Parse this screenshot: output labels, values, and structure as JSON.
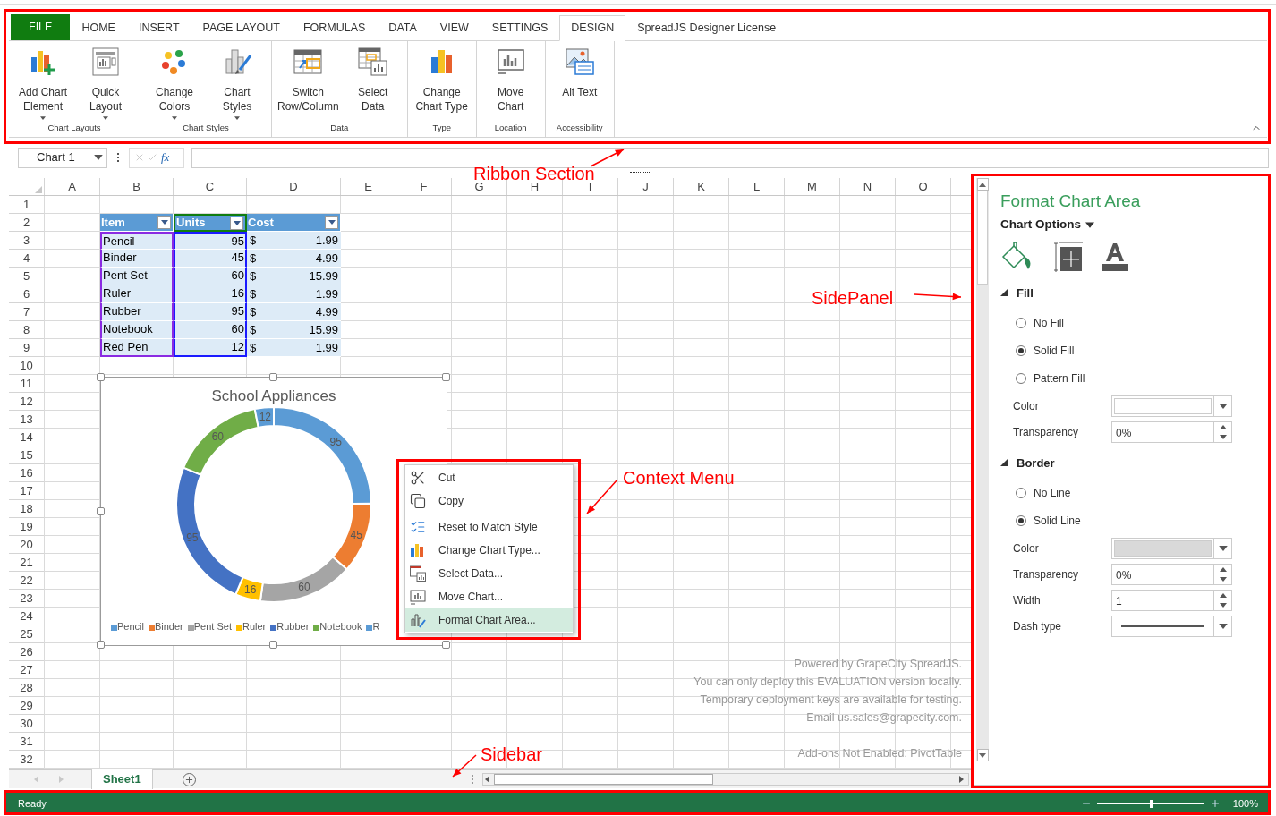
{
  "ribbon": {
    "tabs": [
      {
        "label": "FILE",
        "kind": "file",
        "selected": false
      },
      {
        "label": "HOME",
        "kind": "tab",
        "selected": false
      },
      {
        "label": "INSERT",
        "kind": "tab",
        "selected": false
      },
      {
        "label": "PAGE LAYOUT",
        "kind": "tab",
        "selected": false
      },
      {
        "label": "FORMULAS",
        "kind": "tab",
        "selected": false
      },
      {
        "label": "DATA",
        "kind": "tab",
        "selected": false
      },
      {
        "label": "VIEW",
        "kind": "tab",
        "selected": false
      },
      {
        "label": "SETTINGS",
        "kind": "tab",
        "selected": false
      },
      {
        "label": "DESIGN",
        "kind": "tab",
        "selected": true
      },
      {
        "label": "SpreadJS Designer License",
        "kind": "tab",
        "selected": false
      }
    ],
    "groups": [
      {
        "label": "Chart Layouts",
        "buttons": [
          {
            "label": "Add Chart\nElement",
            "kind": "add-chart",
            "dropdown": true
          },
          {
            "label": "Quick\nLayout",
            "kind": "quick-layout",
            "dropdown": true
          }
        ]
      },
      {
        "label": "Chart Styles",
        "buttons": [
          {
            "label": "Change\nColors",
            "kind": "change-colors",
            "dropdown": true
          },
          {
            "label": "Chart\nStyles",
            "kind": "chart-styles",
            "dropdown": true
          }
        ]
      },
      {
        "label": "Data",
        "buttons": [
          {
            "label": "Switch\nRow/Column",
            "kind": "switch",
            "dropdown": false
          },
          {
            "label": "Select\nData",
            "kind": "select-data",
            "dropdown": false
          }
        ]
      },
      {
        "label": "Type",
        "buttons": [
          {
            "label": "Change\nChart Type",
            "kind": "chart-type",
            "dropdown": false
          }
        ]
      },
      {
        "label": "Location",
        "buttons": [
          {
            "label": "Move\nChart",
            "kind": "move-chart",
            "dropdown": false
          }
        ]
      },
      {
        "label": "Accessibility",
        "buttons": [
          {
            "label": "Alt Text",
            "kind": "alt-text",
            "dropdown": false
          }
        ]
      }
    ]
  },
  "formula_bar": {
    "name_box": "Chart 1",
    "fx": "fx"
  },
  "sheet": {
    "columns": [
      "A",
      "B",
      "C",
      "D",
      "E",
      "F",
      "G",
      "H",
      "I",
      "J",
      "K",
      "L",
      "M",
      "N",
      "O"
    ],
    "rows": [
      "1",
      "2",
      "3",
      "4",
      "5",
      "6",
      "7",
      "8",
      "9",
      "10",
      "11",
      "12",
      "13",
      "14",
      "15",
      "16",
      "17",
      "18",
      "19",
      "20",
      "21",
      "22",
      "23",
      "24",
      "25",
      "26",
      "27",
      "28",
      "29",
      "30",
      "31",
      "32"
    ],
    "table": {
      "columns": [
        {
          "label": "Item",
          "selected": false,
          "color": "#8a2be2"
        },
        {
          "label": "Units",
          "selected": true,
          "color": "#1a1aff"
        },
        {
          "label": "Cost",
          "selected": false
        }
      ],
      "rows": [
        {
          "item": "Pencil",
          "units": "95",
          "currency": "$",
          "cost": "1.99"
        },
        {
          "item": "Binder",
          "units": "45",
          "currency": "$",
          "cost": "4.99"
        },
        {
          "item": "Pent Set",
          "units": "60",
          "currency": "$",
          "cost": "15.99"
        },
        {
          "item": "Ruler",
          "units": "16",
          "currency": "$",
          "cost": "1.99"
        },
        {
          "item": "Rubber",
          "units": "95",
          "currency": "$",
          "cost": "4.99"
        },
        {
          "item": "Notebook",
          "units": "60",
          "currency": "$",
          "cost": "15.99"
        },
        {
          "item": "Red Pen",
          "units": "12",
          "currency": "$",
          "cost": "1.99"
        }
      ]
    },
    "notice": [
      "Powered by GrapeCity SpreadJS.",
      "You can only deploy this EVALUATION version locally.",
      "Temporary deployment keys are available for testing.",
      "Email us.sales@grapecity.com."
    ],
    "addons": "Add-ons Not Enabled: PivotTable",
    "sheet_tabs": [
      {
        "label": "Sheet1",
        "selected": true
      }
    ]
  },
  "chart": {
    "chart_data": {
      "type": "donut",
      "title": "School Appliances",
      "categories": [
        "Pencil",
        "Binder",
        "Pent Set",
        "Ruler",
        "Rubber",
        "Notebook",
        "R"
      ],
      "colors": [
        "#5b9bd5",
        "#ed7d31",
        "#a5a5a5",
        "#ffc000",
        "#4472c4",
        "#70ad47",
        "#5b9bd5"
      ],
      "series": [
        {
          "values": [
            95,
            45,
            60,
            16,
            95,
            60,
            12
          ]
        }
      ],
      "data_labels": true
    }
  },
  "context_menu": [
    {
      "label": "Cut",
      "kind": "cut",
      "selected": false
    },
    {
      "label": "Copy",
      "kind": "copy",
      "selected": false
    },
    {
      "kind": "separator"
    },
    {
      "label": "Reset to Match Style",
      "kind": "reset",
      "selected": false
    },
    {
      "label": "Change Chart Type...",
      "kind": "chart-type",
      "selected": false
    },
    {
      "label": "Select Data...",
      "kind": "select-data",
      "selected": false
    },
    {
      "label": "Move Chart...",
      "kind": "move-chart",
      "selected": false
    },
    {
      "label": "Format Chart Area...",
      "kind": "format",
      "selected": true
    }
  ],
  "side_panel": {
    "title": "Format Chart Area",
    "options_label": "Chart Options",
    "sections": [
      {
        "title": "Fill",
        "expanded": true,
        "options": [
          {
            "label": "No Fill",
            "selected": false
          },
          {
            "label": "Solid Fill",
            "selected": true
          },
          {
            "label": "Pattern Fill",
            "selected": false
          }
        ],
        "fields": [
          {
            "label": "Color",
            "kind": "color",
            "color": "#ffffff"
          },
          {
            "label": "Transparency",
            "kind": "spin",
            "value": "0%"
          }
        ]
      },
      {
        "title": "Border",
        "expanded": true,
        "options": [
          {
            "label": "No Line",
            "selected": false
          },
          {
            "label": "Solid Line",
            "selected": true
          }
        ],
        "fields": [
          {
            "label": "Color",
            "kind": "color",
            "color": "#d9d9d9"
          },
          {
            "label": "Transparency",
            "kind": "spin",
            "value": "0%"
          },
          {
            "label": "Width",
            "kind": "spin",
            "value": "1"
          },
          {
            "label": "Dash type",
            "kind": "dash"
          }
        ]
      }
    ]
  },
  "status_bar": {
    "text": "Ready",
    "zoom": {
      "level": 0.5,
      "reading": "100%"
    }
  },
  "annotations": [
    {
      "label": "Ribbon Section",
      "kind": "ribbon"
    },
    {
      "label": "SidePanel",
      "kind": "side-panel"
    },
    {
      "label": "Context Menu",
      "kind": "context-menu"
    },
    {
      "label": "Sidebar",
      "kind": "status-bar"
    }
  ]
}
